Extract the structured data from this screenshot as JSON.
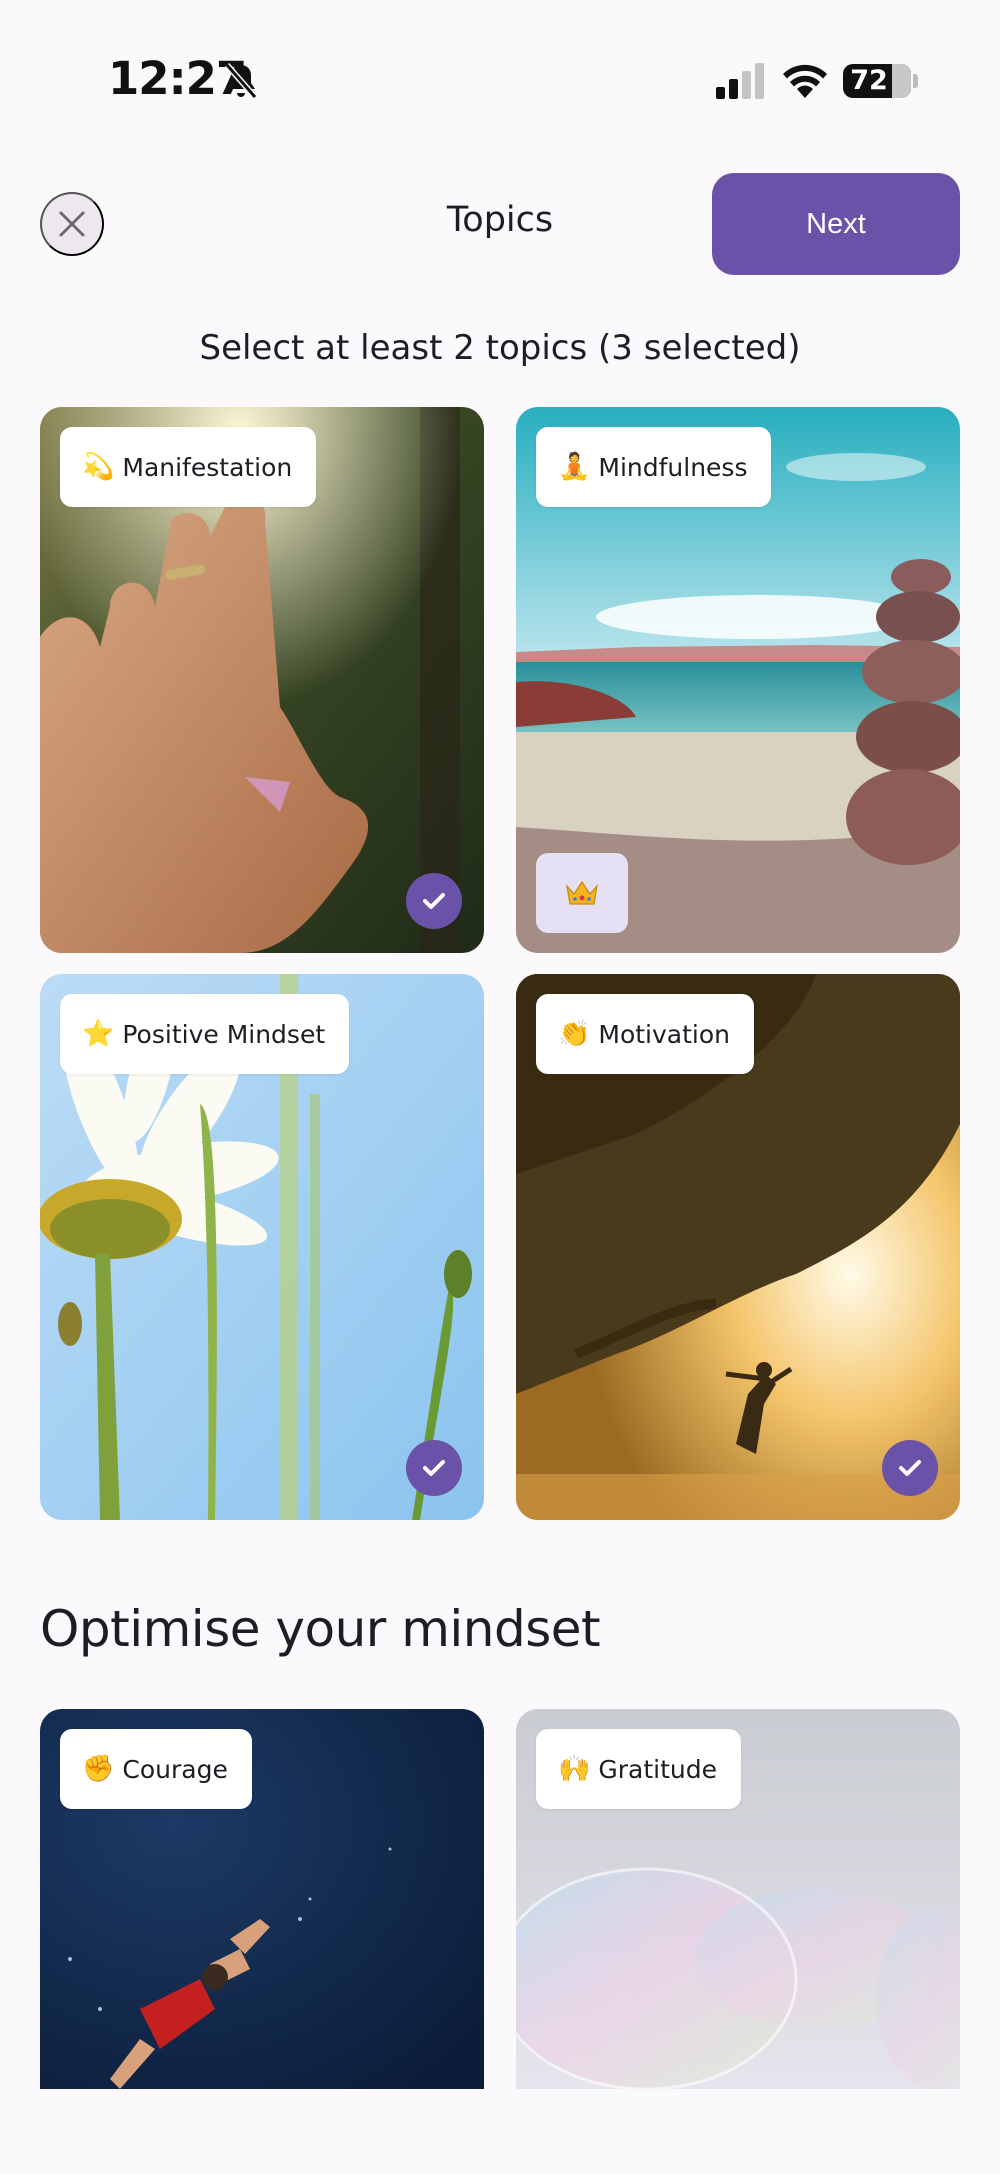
{
  "status_bar": {
    "time": "12:27",
    "battery_level": "72",
    "battery_fraction": 0.72,
    "icons": [
      "bell-slash-icon",
      "cellular-signal-icon",
      "wifi-icon",
      "battery-icon"
    ]
  },
  "header": {
    "title": "Topics",
    "next_label": "Next",
    "close_icon": "close-icon"
  },
  "subtitle": "Select at least 2 topics (3 selected)",
  "colors": {
    "accent": "#6a52a8",
    "background": "#fcf9fc",
    "premium_badge": "#e6e0f5"
  },
  "topics": [
    {
      "label": "Manifestation",
      "emoji": "💫",
      "selected": true,
      "premium": false
    },
    {
      "label": "Mindfulness",
      "emoji": "🧘",
      "selected": false,
      "premium": true
    },
    {
      "label": "Positive Mindset",
      "emoji": "⭐",
      "selected": true,
      "premium": false
    },
    {
      "label": "Motivation",
      "emoji": "👏",
      "selected": true,
      "premium": false
    }
  ],
  "section": {
    "heading": "Optimise your mindset",
    "topics": [
      {
        "label": "Courage",
        "emoji": "✊"
      },
      {
        "label": "Gratitude",
        "emoji": "🙌"
      }
    ]
  }
}
